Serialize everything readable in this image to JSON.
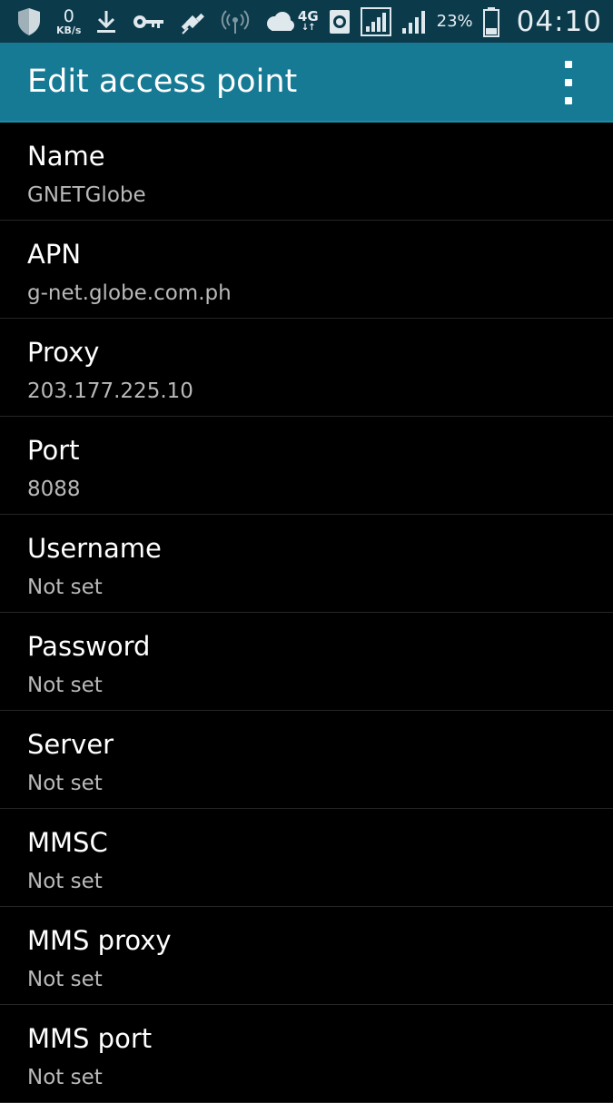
{
  "status_bar": {
    "speed_value": "0",
    "speed_unit": "KB/s",
    "network_type": "4G",
    "network_arrows": "↓↑",
    "battery_percent": "23%",
    "time": "04:10",
    "icons": [
      "shield-icon",
      "download-icon",
      "key-icon",
      "satellite-icon",
      "hotspot-icon",
      "cloud-icon",
      "network-4g-icon",
      "globe-icon",
      "signal-icon-1",
      "signal-icon-2",
      "battery-icon"
    ]
  },
  "app_bar": {
    "title": "Edit access point",
    "overflow_icon": "more-vert-icon"
  },
  "fields": [
    {
      "label": "Name",
      "value": "GNETGlobe"
    },
    {
      "label": "APN",
      "value": "g-net.globe.com.ph"
    },
    {
      "label": "Proxy",
      "value": "203.177.225.10"
    },
    {
      "label": "Port",
      "value": "8088"
    },
    {
      "label": "Username",
      "value": "Not set"
    },
    {
      "label": "Password",
      "value": "Not set"
    },
    {
      "label": "Server",
      "value": "Not set"
    },
    {
      "label": "MMSC",
      "value": "Not set"
    },
    {
      "label": "MMS proxy",
      "value": "Not set"
    },
    {
      "label": "MMS port",
      "value": "Not set"
    }
  ],
  "colors": {
    "status_bar_bg": "#0b3a4b",
    "app_bar_bg": "#177a94",
    "list_bg": "#000000",
    "label": "#ffffff",
    "value": "#b9b9b9",
    "divider": "#262626"
  }
}
